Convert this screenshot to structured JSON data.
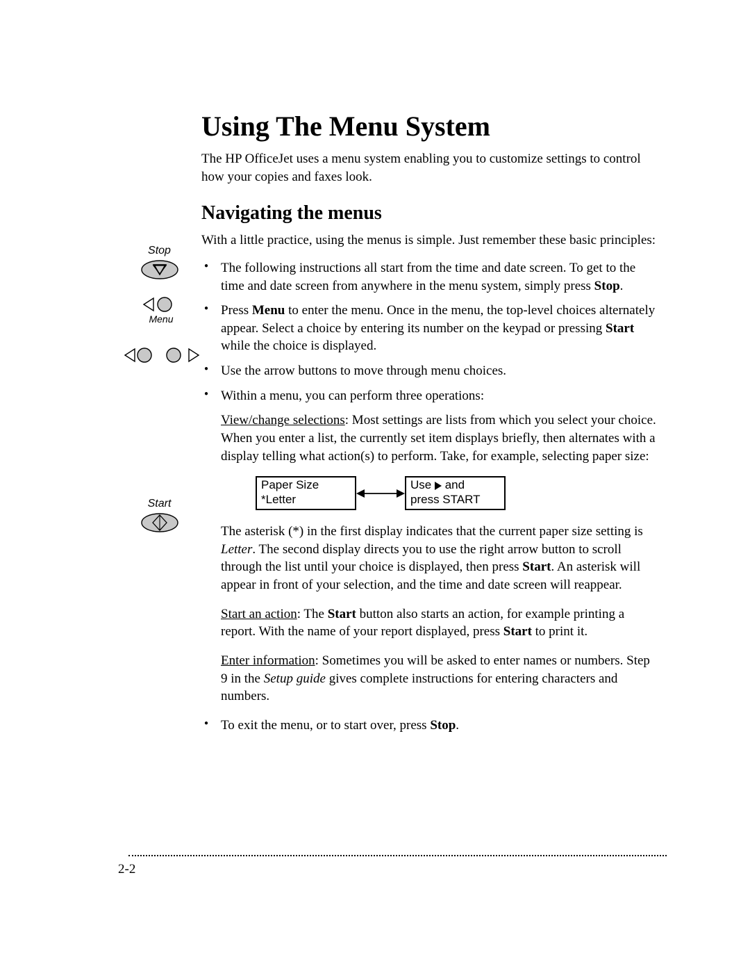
{
  "title": "Using The Menu System",
  "intro": "The HP OfficeJet uses a menu system enabling you to customize settings to control how your copies and faxes look.",
  "section_heading": "Navigating the menus",
  "section_intro": "With a little practice, using the menus is simple. Just remember these basic principles:",
  "margin": {
    "stop": "Stop",
    "menu": "Menu",
    "start": "Start"
  },
  "bullets": {
    "b1a": "The following instructions all start from the time and date screen. To get to the time and date screen from anywhere in the menu system, simply press ",
    "b1_stop": "Stop",
    "b1b": ".",
    "b2a": "Press ",
    "b2_menu": "Menu",
    "b2b": " to enter the menu. Once in the menu, the top-level choices alternately appear. Select a choice by entering its number on the keypad or pressing ",
    "b2_start": "Start",
    "b2c": " while the choice is displayed.",
    "b3": "Use the arrow buttons to move through menu choices.",
    "b4": "Within a menu, you can perform three operations:",
    "b5a": "To exit the menu, or to start over, press ",
    "b5_stop": "Stop",
    "b5b": "."
  },
  "sub": {
    "view_label": "View/change selections",
    "view_text": ": Most settings are lists from which you select your choice. When you enter a list, the currently set item displays briefly, then alternates with a display telling what action(s) to perform. Take, for example, selecting paper size:",
    "after_diag_a": "The asterisk (*) in the first display indicates that the current paper size setting is ",
    "after_diag_letter": "Letter",
    "after_diag_b": ". The second display directs you to use the right arrow button to scroll through the list until your choice is displayed, then press ",
    "after_diag_start": "Start",
    "after_diag_c": ". An asterisk will appear in front of your selection, and the time and date screen will reappear.",
    "start_action_label": "Start an action",
    "start_action_a": ": The ",
    "start_action_start": "Start",
    "start_action_b": " button also starts an action, for example printing a report. With the name of your report displayed, press ",
    "start_action_start2": "Start",
    "start_action_c": " to print it.",
    "enter_info_label": "Enter information",
    "enter_info_a": ": Sometimes you will be asked to enter names or numbers. Step 9 in the ",
    "enter_info_guide": "Setup guide",
    "enter_info_b": " gives complete instructions for entering characters and numbers."
  },
  "lcd": {
    "left_top": "Paper Size",
    "left_bottom": "*Letter",
    "right_top_a": "Use ",
    "right_top_b": " and",
    "right_bottom": "press START"
  },
  "page_number": "2-2"
}
